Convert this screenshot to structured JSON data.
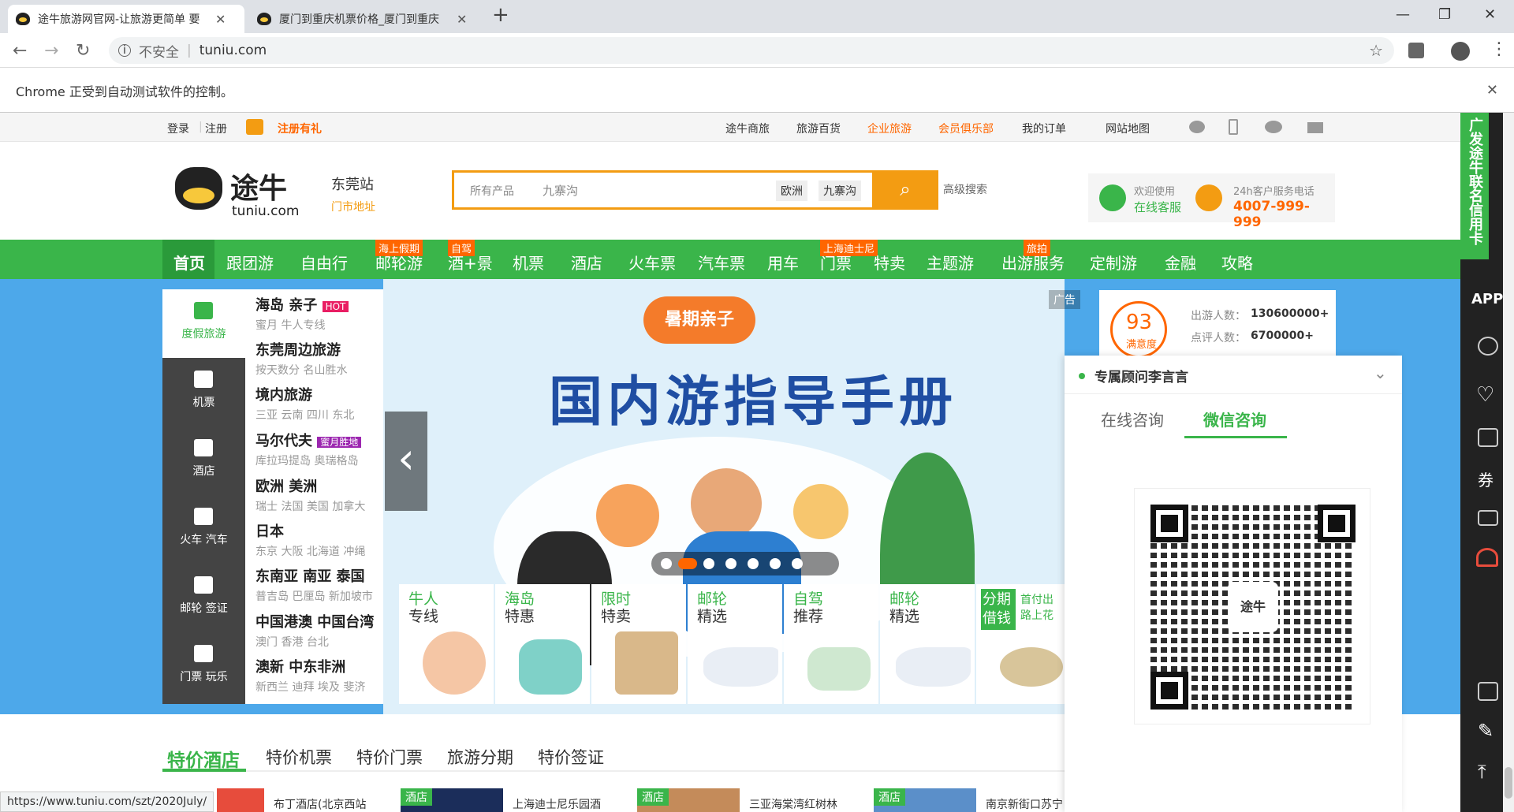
{
  "browser": {
    "tabs": [
      {
        "title": "途牛旅游网官网-让旅游更简单 要",
        "active": true
      },
      {
        "title": "厦门到重庆机票价格_厦门到重庆",
        "active": false
      }
    ],
    "new_tab": "+",
    "security_label": "不安全",
    "url": "tuniu.com",
    "automation_notice": "Chrome 正受到自动测试软件的控制。",
    "status_url": "https://www.tuniu.com/szt/2020July/"
  },
  "topnav": {
    "login": "登录",
    "register": "注册",
    "gift": "注册有礼",
    "links": [
      "途牛商旅",
      "旅游百货",
      "企业旅游",
      "会员俱乐部",
      "我的订单",
      "网站地图"
    ]
  },
  "header": {
    "logo_text": "途牛",
    "logo_sub": "tuniu.com",
    "station": "东莞站",
    "store": "门市地址",
    "search_category": "所有产品",
    "search_placeholder": "九寨沟",
    "search_tags": [
      "欧洲",
      "九寨沟"
    ],
    "advanced": "高级搜索",
    "service_label": "欢迎使用",
    "service_link": "在线客服",
    "phone_label": "24h客户服务电话",
    "phone": "4007-999-999"
  },
  "mainnav": {
    "items": [
      "首页",
      "跟团游",
      "自由行",
      "邮轮游",
      "酒+景",
      "机票",
      "酒店",
      "火车票",
      "汽车票",
      "用车",
      "门票",
      "特卖",
      "主题游",
      "出游服务",
      "定制游",
      "金融",
      "攻略"
    ],
    "tags": [
      "海上假期",
      "自驾",
      "上海迪士尼",
      "旅拍"
    ]
  },
  "categories": {
    "side": [
      "度假旅游",
      "机票",
      "酒店",
      "火车 汽车",
      "邮轮 签证",
      "门票 玩乐"
    ],
    "rows": [
      {
        "title": "海岛 亲子",
        "badge": "HOT",
        "sub": "蜜月 牛人专线"
      },
      {
        "title": "东莞周边旅游",
        "sub": "按天数分 名山胜水"
      },
      {
        "title": "境内旅游",
        "sub": "三亚 云南 四川 东北"
      },
      {
        "title": "马尔代夫",
        "badge": "蜜月胜地",
        "sub": "库拉玛提岛 奥瑞格岛"
      },
      {
        "title": "欧洲 美洲",
        "sub": "瑞士 法国 美国 加拿大"
      },
      {
        "title": "日本",
        "sub": "东京 大阪 北海道 冲绳"
      },
      {
        "title": "东南亚 南亚 泰国",
        "sub": "普吉岛 巴厘岛 新加坡市"
      },
      {
        "title": "中国港澳 中国台湾",
        "sub": "澳门 香港 台北"
      },
      {
        "title": "澳新 中东非洲",
        "sub": "新西兰 迪拜 埃及 斐济"
      }
    ]
  },
  "banner": {
    "tag": "暑期亲子",
    "title": "国内游指导手册",
    "ad": "广告",
    "satisfaction": "93",
    "satisfaction_label": "满意度",
    "visitors_label": "出游人数：",
    "visitors": "130600000+",
    "reviews_label": "点评人数：",
    "reviews": "6700000+",
    "tiles": [
      [
        "牛人",
        "专线"
      ],
      [
        "海岛",
        "特惠"
      ],
      [
        "限时",
        "特卖"
      ],
      [
        "邮轮",
        "精选"
      ],
      [
        "自驾",
        "推荐"
      ],
      [
        "邮轮",
        "精选"
      ],
      [
        "分期",
        "借钱"
      ]
    ],
    "tile_extra": "首付出 路上花"
  },
  "consult": {
    "title": "专属顾问李言言",
    "tab_online": "在线咨询",
    "tab_wechat": "微信咨询",
    "qr_logo": "途牛"
  },
  "deals": {
    "tabs": [
      "特价酒店",
      "特价机票",
      "特价门票",
      "旅游分期",
      "特价签证"
    ],
    "cards": [
      {
        "label": "",
        "text": "布丁酒店(北京西站"
      },
      {
        "label": "酒店",
        "text": "上海迪士尼乐园酒"
      },
      {
        "label": "酒店",
        "text": "三亚海棠湾红树林"
      },
      {
        "label": "酒店",
        "text": "南京新街口苏宁"
      }
    ]
  },
  "sidebar": {
    "promo": "广发途牛联名信用卡",
    "app": "APP",
    "coupon": "券"
  }
}
